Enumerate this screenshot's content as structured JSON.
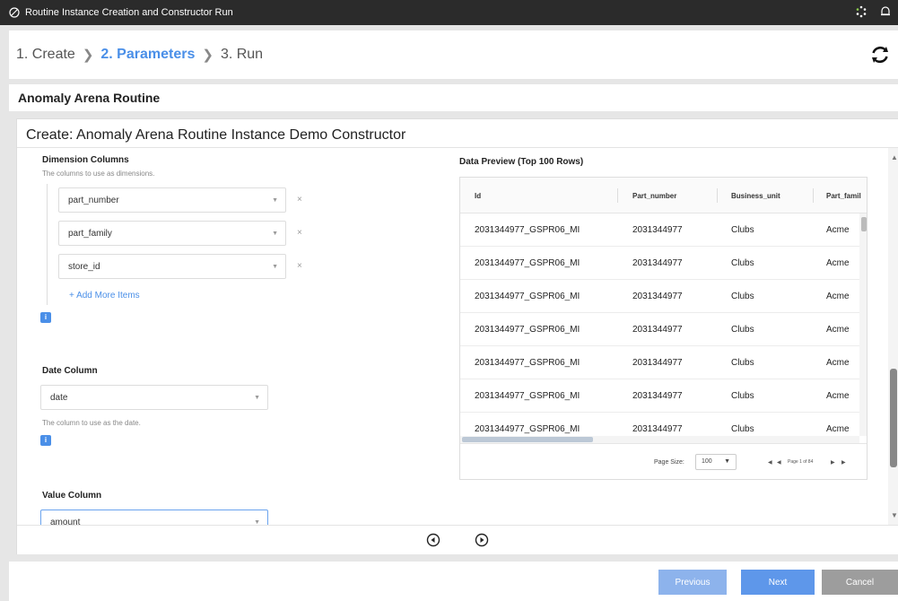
{
  "window": {
    "title": "Routine Instance Creation and Constructor Run"
  },
  "steps": [
    {
      "label": "1. Create"
    },
    {
      "label": "2. Parameters"
    },
    {
      "label": "3. Run"
    }
  ],
  "routine_name": "Anomaly Arena Routine",
  "panel_title": "Create: Anomaly Arena Routine Instance Demo Constructor",
  "dimension": {
    "label": "Dimension Columns",
    "help": "The columns to use as dimensions.",
    "items": [
      {
        "value": "part_number"
      },
      {
        "value": "part_family"
      },
      {
        "value": "store_id"
      }
    ],
    "remove_symbol": "×",
    "add_more": "+ Add More Items"
  },
  "date_col": {
    "label": "Date Column",
    "value": "date",
    "help": "The column to use as the date."
  },
  "value_col": {
    "label": "Value Column",
    "value": "amount"
  },
  "info_symbol": "i",
  "caret_symbol": "▼",
  "preview": {
    "title": "Data Preview (Top 100 Rows)",
    "columns": [
      "Id",
      "Part_number",
      "Business_unit",
      "Part_famil"
    ],
    "rows": [
      [
        "2031344977_GSPR06_MI",
        "2031344977",
        "Clubs",
        "Acme"
      ],
      [
        "2031344977_GSPR06_MI",
        "2031344977",
        "Clubs",
        "Acme"
      ],
      [
        "2031344977_GSPR06_MI",
        "2031344977",
        "Clubs",
        "Acme"
      ],
      [
        "2031344977_GSPR06_MI",
        "2031344977",
        "Clubs",
        "Acme"
      ],
      [
        "2031344977_GSPR06_MI",
        "2031344977",
        "Clubs",
        "Acme"
      ],
      [
        "2031344977_GSPR06_MI",
        "2031344977",
        "Clubs",
        "Acme"
      ],
      [
        "2031344977_GSPR06_MI",
        "2031344977",
        "Clubs",
        "Acme"
      ]
    ],
    "page_size_label": "Page Size:",
    "page_size_value": "100",
    "page_info": "Page 1 of 84"
  },
  "buttons": {
    "previous": "Previous",
    "next": "Next",
    "cancel": "Cancel"
  }
}
